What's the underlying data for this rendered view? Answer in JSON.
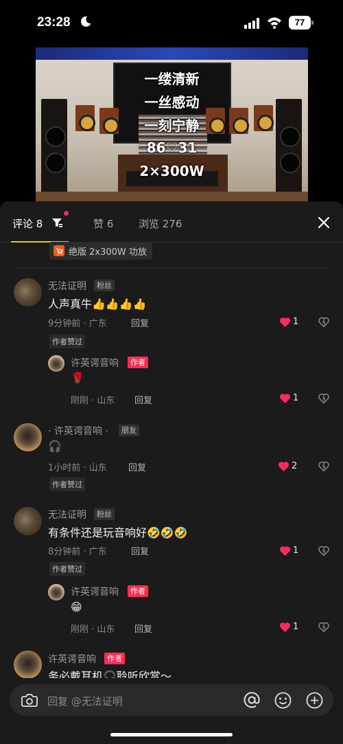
{
  "status_bar": {
    "time": "23:28",
    "battery": "77"
  },
  "video": {
    "overlay_lines": [
      "一缕清新",
      "一丝感动",
      "一刻宁静",
      "86♡31",
      "2×300W"
    ]
  },
  "tabs": {
    "comments": "评论 8",
    "likes": "赞 6",
    "views": "浏览 276"
  },
  "product": {
    "label": "绝版 2x300W 功放"
  },
  "comments": [
    {
      "user": "无法证明",
      "tag": "粉丝",
      "text": "人声真牛👍👍👍👍",
      "meta": "9分钟前 · 广东",
      "reply_label": "回复",
      "likes": "1",
      "badge": "作者赞过",
      "reply": {
        "user": "许英谔音响",
        "tag": "作者",
        "text": "🌹",
        "meta": "刚刚 · 山东",
        "reply_label": "回复",
        "likes": "1"
      }
    },
    {
      "user": "· 许英谔音响 ·",
      "tag": "朋友",
      "text": "🎧",
      "meta": "1小时前 · 山东",
      "reply_label": "回复",
      "likes": "2",
      "badge": "作者赞过"
    },
    {
      "user": "无法证明",
      "tag": "粉丝",
      "text": "有条件还是玩音响好🤣🤣🤣",
      "meta": "8分钟前 · 广东",
      "reply_label": "回复",
      "likes": "1",
      "badge": "作者赞过",
      "reply": {
        "user": "许英谔音响",
        "tag": "作者",
        "text": "😁",
        "meta": "刚刚 · 山东",
        "reply_label": "回复",
        "likes": "1"
      }
    },
    {
      "user": "许英谔音响",
      "tag": "作者",
      "text": "务必戴耳机🎧聆听欣赏～"
    }
  ],
  "input": {
    "placeholder": "回复 @无法证明"
  },
  "colors": {
    "accent": "#f1c40f",
    "heart": "#fe2c55",
    "author_tag": "#fe2c55",
    "sheet_bg": "#1b1b1b"
  }
}
